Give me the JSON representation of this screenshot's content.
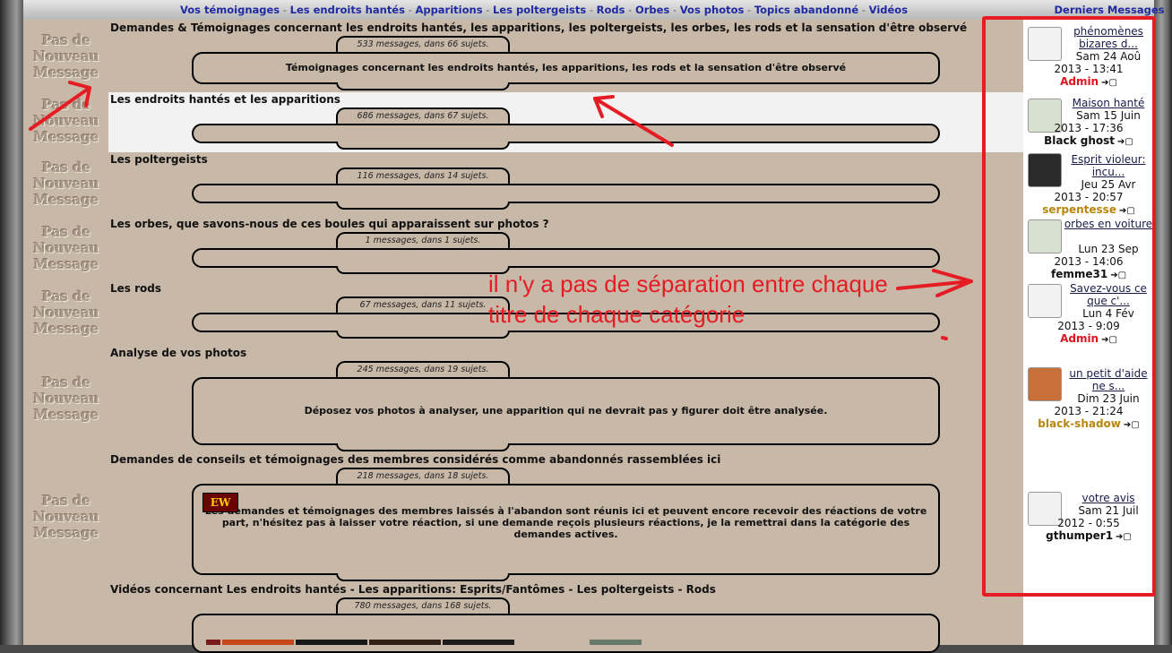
{
  "nav": {
    "links": [
      "Vos témoignages",
      "Les endroits hantés",
      "Apparitions",
      "Les poltergeists",
      "Rods",
      "Orbes",
      "Vos photos",
      "Topics abandonné",
      "Vidéos"
    ],
    "separator": " - ",
    "recent_title": "Derniers Messages"
  },
  "status_icon_label": "Pas de Nouveau Message",
  "categories": [
    {
      "title": "Demandes & Témoignages concernant les endroits hantés, les apparitions, les poltergeists, les orbes, les rods et la sensation d'être observé",
      "stats": "533 messages, dans 66 sujets.",
      "description": "Témoignages concernant les endroits hantés, les apparitions, les rods et la sensation d'être observé"
    },
    {
      "title": "Les endroits hantés et les apparitions",
      "stats": "686 messages, dans 67 sujets.",
      "description": ""
    },
    {
      "title": "Les poltergeists",
      "stats": "116 messages, dans 14 sujets.",
      "description": ""
    },
    {
      "title": "Les orbes, que savons-nous de ces boules qui apparaissent sur photos ?",
      "stats": "1 messages, dans 1 sujets.",
      "description": ""
    },
    {
      "title": "Les rods",
      "stats": "67 messages, dans 11 sujets.",
      "description": ""
    },
    {
      "title": "Analyse de vos photos",
      "stats": "245 messages, dans 19 sujets.",
      "description": "Déposez vos photos à analyser, une apparition qui ne devrait pas y figurer doit être analysée."
    },
    {
      "title": "Demandes de conseils et témoignages des membres considérés comme abandonnés rassemblées ici",
      "stats": "218 messages, dans 18 sujets.",
      "description": "Les demandes et témoignages des membres laissés à l'abandon sont réunis ici et peuvent encore recevoir des réactions de votre part, n'hésitez pas à laisser votre réaction, si une demande reçois plusieurs réactions, je la remettrai dans la catégorie des demandes actives.",
      "logo_text": "EW"
    },
    {
      "title": "Vidéos concernant Les endroits hantés - Les apparitions: Esprits/Fantômes - Les poltergeists - Rods",
      "stats": "780 messages, dans 168 sujets.",
      "description": ""
    }
  ],
  "recent_posts": [
    {
      "title": "phénomènes bizares d...",
      "date1": "Sam 24 Aoû",
      "date2": "2013 - 13:41",
      "author": "Admin",
      "author_color": "#e0141e",
      "avatar": "forum-logo-avatar",
      "avatar_color": "#f2f2f2"
    },
    {
      "title": "Maison hanté",
      "date1": "Sam 15 Juin",
      "date2": "2013 - 17:36",
      "author": "Black ghost",
      "author_color": "#111111",
      "avatar": "default-user-avatar",
      "avatar_color": "#d8e0d0"
    },
    {
      "title": "Esprit violeur: incu...",
      "date1": "Jeu 25 Avr",
      "date2": "2013 - 20:57",
      "author": "serpentesse",
      "author_color": "#b8860b",
      "avatar": "dark-photo-avatar",
      "avatar_color": "#2a2a2a"
    },
    {
      "title": "orbes en voiture",
      "date1": "Lun 23 Sep",
      "date2": "2013 - 14:06",
      "author": "femme31",
      "author_color": "#111111",
      "avatar": "default-user-avatar",
      "avatar_color": "#d8e0d0"
    },
    {
      "title": "Savez-vous ce que c'...",
      "date1": "Lun 4 Fév",
      "date2": "2013 - 9:09",
      "author": "Admin",
      "author_color": "#e0141e",
      "avatar": "forum-logo-avatar",
      "avatar_color": "#f2f2f2"
    },
    {
      "title": "un petit d'aide ne s...",
      "date1": "Dim 23 Juin",
      "date2": "2013 - 21:24",
      "author": "black-shadow",
      "author_color": "#b8860b",
      "avatar": "cake-avatar",
      "avatar_color": "#c8703a"
    },
    {
      "title": "votre avis",
      "date1": "Sam 21 Juil",
      "date2": "2012 - 0:55",
      "author": "gthumper1",
      "author_color": "#111111",
      "avatar": "penguin-avatar",
      "avatar_color": "#f0f0f0"
    }
  ],
  "annotation": {
    "text": "il n'y a pas de séparation entre chaque titre de chaque catégorie",
    "color": "#e51c23"
  }
}
